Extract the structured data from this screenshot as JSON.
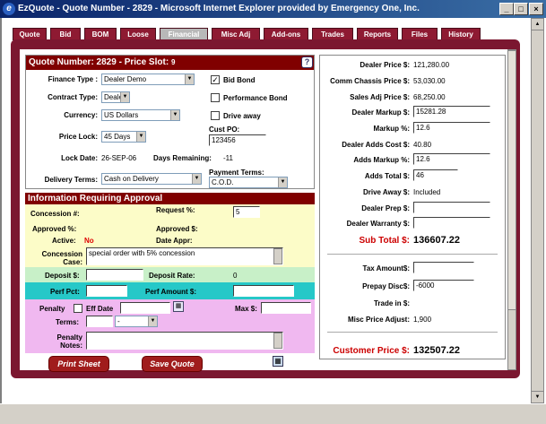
{
  "window": {
    "title": "EzQuote - Quote Number - 2829 - Microsoft Internet Explorer provided by Emergency One, Inc."
  },
  "tabs": [
    "Quote",
    "Bid",
    "BOM",
    "Loose",
    "Financial",
    "Misc Adj",
    "Add-ons",
    "Trades",
    "Reports",
    "Files",
    "History"
  ],
  "active_tab": "Financial",
  "quote": {
    "header": "Quote Number: 2829 - Price Slot:",
    "slot": "9",
    "finance_type_label": "Finance Type :",
    "finance_type": "Dealer Demo",
    "contract_type_label": "Contract Type:",
    "contract_type": "Dealer",
    "currency_label": "Currency:",
    "currency": "US Dollars",
    "price_lock_label": "Price Lock:",
    "price_lock": "45 Days",
    "bid_bond_label": "Bid Bond",
    "performance_bond_label": "Performance Bond",
    "drive_away_label": "Drive away",
    "cust_po_label": "Cust PO:",
    "cust_po": "123456",
    "lock_date_label": "Lock Date:",
    "lock_date": "26-SEP-06",
    "days_remaining_label": "Days Remaining:",
    "days_remaining": "-11",
    "delivery_terms_label": "Delivery Terms:",
    "delivery_terms": "Cash on Delivery",
    "payment_terms_label": "Payment Terms:",
    "payment_terms": "C.O.D."
  },
  "approval": {
    "header": "Information Requiring Approval",
    "concession_label": "Concession #:",
    "request_pct_label": "Request %:",
    "request_pct": "5",
    "approved_pct_label": "Approved %:",
    "approved_amt_label": "Approved $:",
    "active_label": "Active:",
    "active": "No",
    "date_appr_label": "Date Appr:",
    "concession_case_label": "Concession Case:",
    "concession_case": "special order with 5% concession",
    "deposit_label": "Deposit $:",
    "deposit_rate_label": "Deposit Rate:",
    "deposit_rate": "0",
    "perf_pct_label": "Perf Pct:",
    "perf_amount_label": "Perf Amount $:",
    "penalty_label": "Penalty",
    "eff_date_label": "Eff Date",
    "max_label": "Max $:",
    "terms_label": "Terms:",
    "terms_value": "-",
    "penalty_notes_label": "Penalty Notes:"
  },
  "buttons": {
    "print": "Print Sheet",
    "save": "Save Quote"
  },
  "pricing": {
    "dealer_price_label": "Dealer Price $:",
    "dealer_price": "121,280.00",
    "comm_chassis_label": "Comm Chassis Price $:",
    "comm_chassis": "53,030.00",
    "sales_adj_label": "Sales Adj Price $:",
    "sales_adj": "68,250.00",
    "dealer_markup_label": "Dealer Markup $:",
    "dealer_markup": "15281.28",
    "markup_pct_label": "Markup %:",
    "markup_pct": "12.6",
    "dealer_adds_label": "Dealer Adds Cost $:",
    "dealer_adds": "40.80",
    "adds_markup_label": "Adds Markup %:",
    "adds_markup": "12.6",
    "adds_total_label": "Adds Total $:",
    "adds_total": "46",
    "drive_away_label": "Drive Away $:",
    "drive_away": "Included",
    "dealer_prep_label": "Dealer Prep $:",
    "dealer_warranty_label": "Dealer Warranty $:",
    "subtotal_label": "Sub Total $:",
    "subtotal": "136607.22",
    "tax_label": "Tax Amount$:",
    "prepay_label": "Prepay Disc$:",
    "prepay": "-6000",
    "trade_label": "Trade in $:",
    "misc_label": "Misc Price Adjust:",
    "misc": "1,900",
    "customer_label": "Customer Price $:",
    "customer_price": "132507.22"
  },
  "colors": {
    "maroon": "#7b1730",
    "header_red": "#800000",
    "yellow": "#fcfcc8",
    "green": "#c8f0c8",
    "cyan": "#26c8c8",
    "pink": "#f0b8f0"
  }
}
